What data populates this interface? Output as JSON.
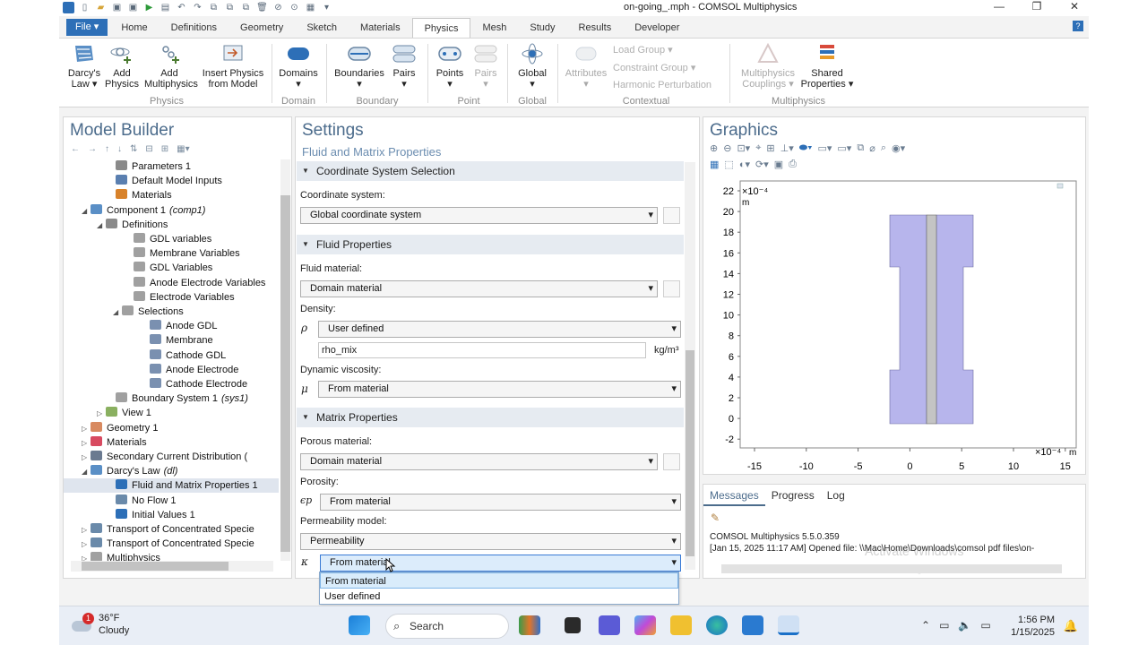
{
  "window": {
    "title": "on-going_.mph - COMSOL Multiphysics"
  },
  "tabs": {
    "file": "File ▾",
    "items": [
      "Home",
      "Definitions",
      "Geometry",
      "Sketch",
      "Materials",
      "Physics",
      "Mesh",
      "Study",
      "Results",
      "Developer"
    ],
    "active": "Physics",
    "help": "?"
  },
  "ribbon": {
    "darcys_law": "Darcy's\nLaw ▾",
    "add_physics": "Add\nPhysics",
    "add_multiphysics": "Add\nMultiphysics",
    "insert_physics": "Insert Physics\nfrom Model",
    "domains": "Domains\n▾",
    "boundaries": "Boundaries\n▾",
    "pairs": "Pairs\n▾",
    "points": "Points\n▾",
    "pairs2": "Pairs\n▾",
    "global": "Global\n▾",
    "attributes": "Attributes\n▾",
    "load_group": "Load Group ▾",
    "constraint_group": "Constraint Group ▾",
    "harmonic_perturbation": "Harmonic Perturbation",
    "multiphysics_couplings": "Multiphysics\nCouplings ▾",
    "shared_properties": "Shared\nProperties ▾",
    "groups": {
      "physics": "Physics",
      "domain": "Domain",
      "boundary": "Boundary",
      "point": "Point",
      "global": "Global",
      "contextual": "Contextual",
      "multiphysics": "Multiphysics"
    }
  },
  "model_builder": {
    "title": "Model Builder",
    "tree": [
      {
        "label": "Parameters 1"
      },
      {
        "label": "Default Model Inputs"
      },
      {
        "label": "Materials"
      },
      {
        "label": "Component 1",
        "suffix": "(comp1)"
      },
      {
        "label": "Definitions"
      },
      {
        "label": "GDL variables"
      },
      {
        "label": "Membrane Variables"
      },
      {
        "label": "GDL Variables"
      },
      {
        "label": "Anode Electrode Variables"
      },
      {
        "label": "Electrode Variables"
      },
      {
        "label": "Selections"
      },
      {
        "label": "Anode GDL"
      },
      {
        "label": "Membrane"
      },
      {
        "label": "Cathode GDL"
      },
      {
        "label": "Anode Electrode"
      },
      {
        "label": "Cathode Electrode"
      },
      {
        "label": "Boundary System 1",
        "suffix": "(sys1)"
      },
      {
        "label": "View 1"
      },
      {
        "label": "Geometry 1"
      },
      {
        "label": "Materials"
      },
      {
        "label": "Secondary Current Distribution (",
        "suffix": ""
      },
      {
        "label": "Darcy's Law",
        "suffix": "(dl)"
      },
      {
        "label": "Fluid and Matrix Properties 1"
      },
      {
        "label": "No Flow 1"
      },
      {
        "label": "Initial Values 1"
      },
      {
        "label": "Transport of Concentrated Specie"
      },
      {
        "label": "Transport of Concentrated Specie"
      },
      {
        "label": "Multiphysics"
      }
    ]
  },
  "settings": {
    "title": "Settings",
    "subtitle": "Fluid and Matrix Properties",
    "sec_coord": "Coordinate System Selection",
    "coord_label": "Coordinate system:",
    "coord_value": "Global coordinate system",
    "sec_fluid": "Fluid Properties",
    "fluid_material_label": "Fluid material:",
    "fluid_material_value": "Domain material",
    "density_label": "Density:",
    "density_symbol": "ρ",
    "density_value": "User defined",
    "density_expr": "rho_mix",
    "density_unit": "kg/m³",
    "viscosity_label": "Dynamic viscosity:",
    "viscosity_symbol": "μ",
    "viscosity_value": "From material",
    "sec_matrix": "Matrix Properties",
    "porous_label": "Porous material:",
    "porous_value": "Domain material",
    "porosity_label": "Porosity:",
    "porosity_symbol": "ϵp",
    "porosity_value": "From material",
    "perm_model_label": "Permeability model:",
    "perm_model_value": "Permeability",
    "kappa_symbol": "κ",
    "kappa_value": "From material",
    "dropdown_options": [
      "From material",
      "User defined"
    ]
  },
  "graphics": {
    "title": "Graphics",
    "y_exponent": "×10⁻⁴",
    "y_unit": "m",
    "x_exponent": "×10⁻⁴",
    "x_unit": "m",
    "y_ticks": [
      "22",
      "20",
      "18",
      "16",
      "14",
      "12",
      "10",
      "8",
      "6",
      "4",
      "2",
      "0",
      "-2"
    ],
    "x_ticks": [
      "-15",
      "-10",
      "-5",
      "0",
      "5",
      "10",
      "15"
    ],
    "fill_color": "#b7b5ec",
    "membrane_color": "#c4c4c4"
  },
  "messages": {
    "tabs": [
      "Messages",
      "Progress",
      "Log"
    ],
    "line1": "COMSOL Multiphysics 5.5.0.359",
    "line2": "[Jan 15, 2025 11:17 AM] Opened file: \\\\Mac\\Home\\Downloads\\comsol pdf files\\on-",
    "watermark1": "Activate Windows",
    "watermark2": "Go to Settings to activate Windows."
  },
  "taskbar": {
    "badge": "1",
    "temp": "36°F",
    "weather": "Cloudy",
    "search": "Search",
    "time": "1:56 PM",
    "date": "1/15/2025"
  }
}
